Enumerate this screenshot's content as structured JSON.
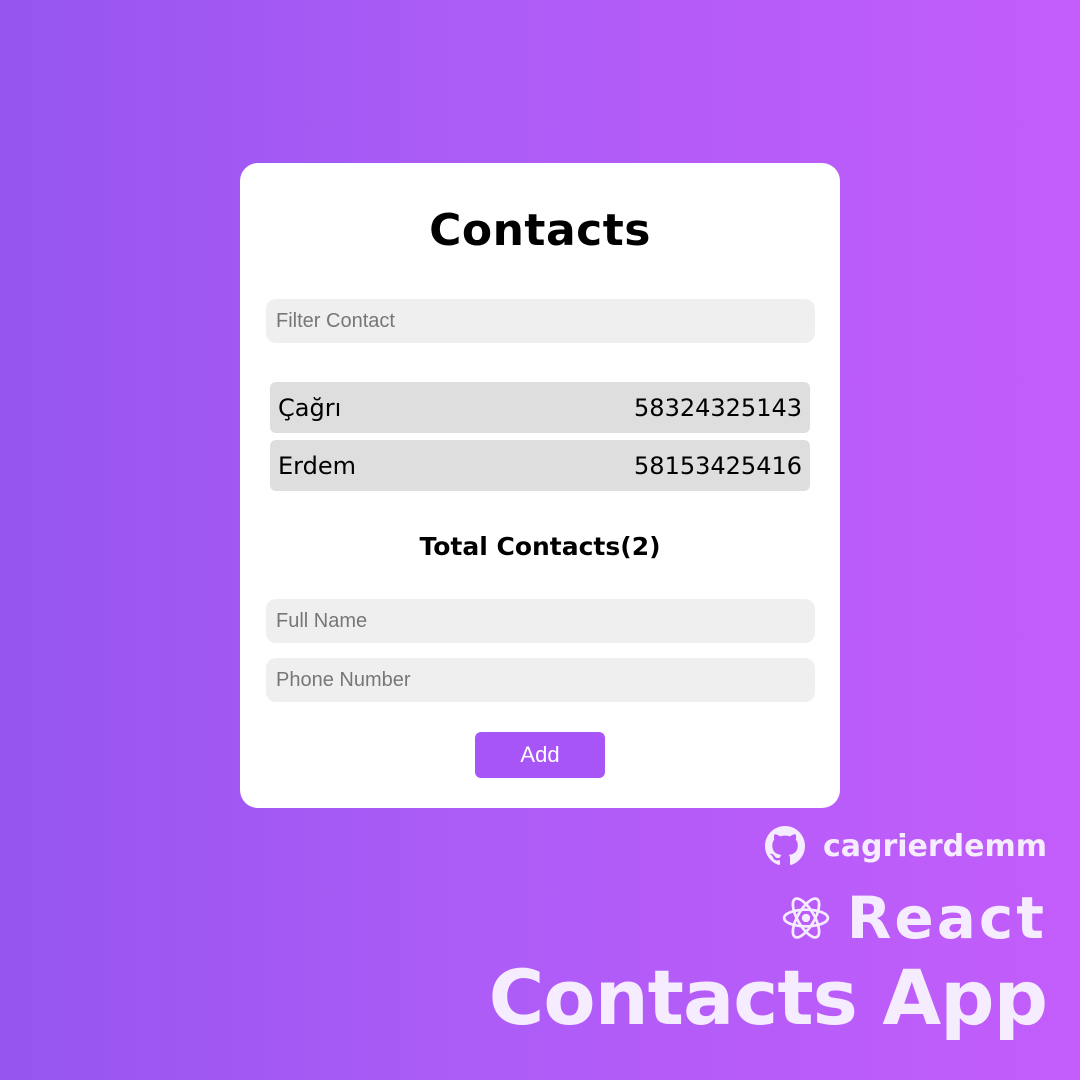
{
  "app": {
    "title": "Contacts",
    "filter": {
      "placeholder": "Filter Contact",
      "value": ""
    },
    "contacts": [
      {
        "name": "Çağrı",
        "phone": "58324325143"
      },
      {
        "name": "Erdem",
        "phone": "58153425416"
      }
    ],
    "total_label": "Total Contacts(2)",
    "form": {
      "fullname_placeholder": "Full Name",
      "phone_placeholder": "Phone Number",
      "add_label": "Add"
    }
  },
  "branding": {
    "github_username": "cagrierdemm",
    "github_icon": "github-icon",
    "framework": "React",
    "framework_icon": "react-icon",
    "project_title": "Contacts App"
  },
  "colors": {
    "background_start": "#9655f0",
    "background_end": "#c35dfb",
    "accent": "#a855f7",
    "card": "#ffffff",
    "field": "#efefef",
    "row": "#dedede"
  }
}
